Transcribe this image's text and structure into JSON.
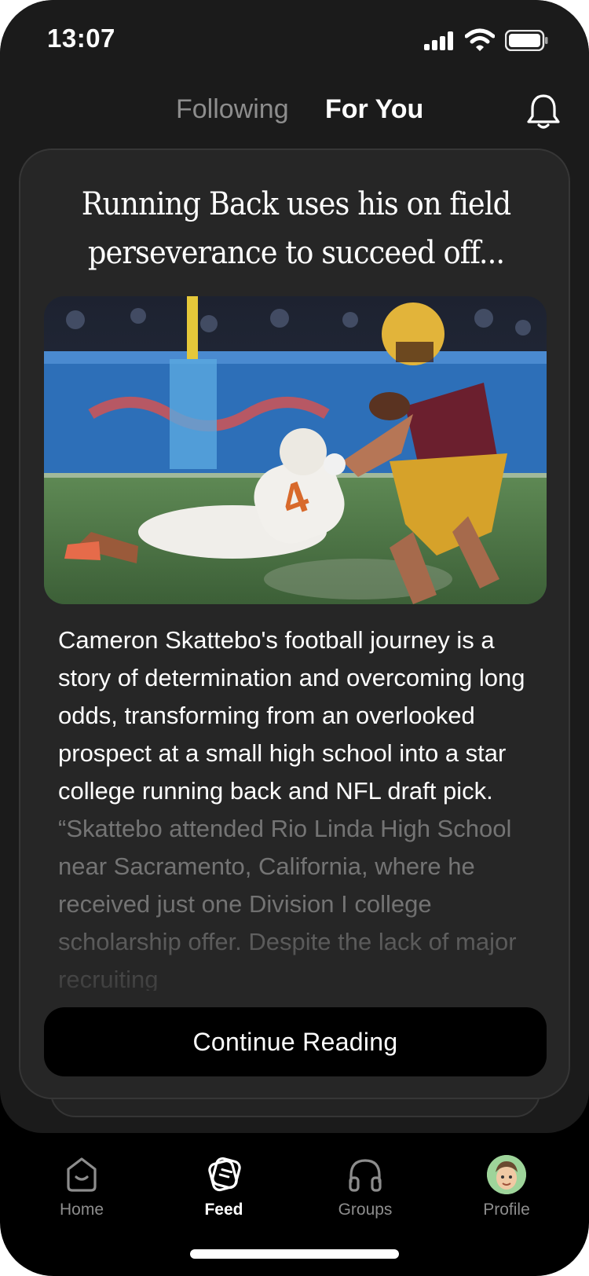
{
  "status_bar": {
    "time": "13:07"
  },
  "header": {
    "tabs": [
      {
        "label": "Following",
        "active": false
      },
      {
        "label": "For You",
        "active": true
      }
    ],
    "notification_icon": "bell-icon"
  },
  "card": {
    "title": "Running Back uses his on field perseverance to succeed off...",
    "image_icon": "football-photo",
    "summary": "Cameron Skattebo's football journey is a story of determination and overcoming long odds, transforming from an overlooked prospect at a small high school into a star college running back and NFL draft pick.",
    "quote": "“Skattebo attended Rio Linda High School near Sacramento, California, where he received just one Division I college scholarship offer. Despite the lack of major recruiting",
    "cta_label": "Continue Reading"
  },
  "bottom_nav": {
    "items": [
      {
        "label": "Home",
        "icon": "home-icon",
        "active": false
      },
      {
        "label": "Feed",
        "icon": "feed-icon",
        "active": true
      },
      {
        "label": "Groups",
        "icon": "headphones-icon",
        "active": false
      },
      {
        "label": "Profile",
        "icon": "avatar",
        "active": false
      }
    ]
  },
  "colors": {
    "background": "#1b1b1b",
    "card": "#262626",
    "text_primary": "#ffffff",
    "text_muted": "#8d8d8d",
    "avatar_bg": "#9ed49a"
  }
}
